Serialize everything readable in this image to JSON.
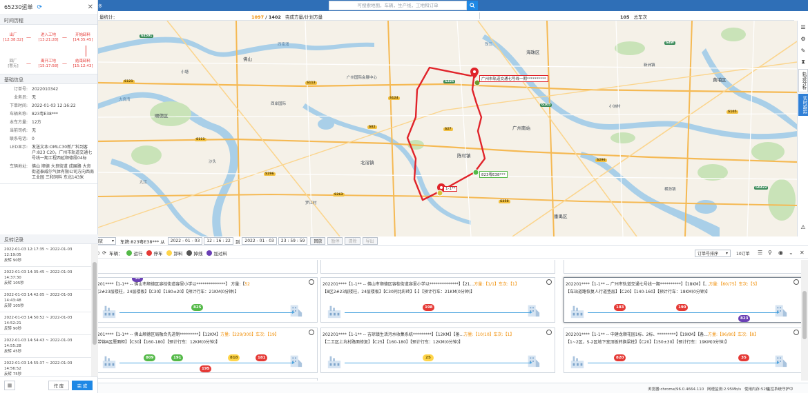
{
  "topbar": {
    "left_text": "多"
  },
  "search": {
    "placeholder": "可搜索地图，车辆，生产线，工地和订单"
  },
  "stats": {
    "left_label": "量统计：",
    "done": "1097",
    "total": "1402",
    "done_label": "完成方量/计划方量",
    "cars": "105",
    "cars_label": "总车次"
  },
  "left_panel": {
    "title": "65230运单",
    "timeline_title": "时间历程",
    "timeline": {
      "out_factory": {
        "label": "出厂",
        "time": "[12:38:32]"
      },
      "in_site": {
        "label": "进入工地",
        "time": "[13:21:28]"
      },
      "start_unload": {
        "label": "开始卸料",
        "time": "[14:35:45]"
      },
      "back_factory": {
        "label": "回厂",
        "time": "[暂无]"
      },
      "leave_site": {
        "label": "离开工地",
        "time": "[15:17:58]"
      },
      "end_unload": {
        "label": "结束卸料",
        "time": "[15:12:43]"
      }
    },
    "basic_title": "基础信息",
    "info": [
      {
        "key": "订单号:",
        "val": "2022010342"
      },
      {
        "key": "业务员:",
        "val": "无"
      },
      {
        "key": "下单时间:",
        "val": "2022-01-03 12:16:22"
      },
      {
        "key": "车辆名称:",
        "val": "823粤E38***"
      },
      {
        "key": "本车方量:",
        "val": "12方"
      },
      {
        "key": "当前司机:",
        "val": "无"
      },
      {
        "key": "联系电话:",
        "val": "0"
      },
      {
        "key": "LED显示:",
        "val": "发送文本:OMLC30新厂料到客户:823 C20，广州市轨道交通七号线一期工程西延顺德段04标"
      },
      {
        "key": "车辆地址:",
        "val": "佛山 顺德 大良街道 成展路 大良街道泰威尔气体有限公司方向西南工业园 三和饲料 东北143米"
      }
    ],
    "records_title": "反转记录",
    "records": [
      {
        "range": "2022-01-03 12:17:35 ~ 2022-01-03 12:19:05",
        "dur": "反转 90秒"
      },
      {
        "range": "2022-01-03 14:35:45 ~ 2022-01-03 14:37:30",
        "dur": "反转 105秒"
      },
      {
        "range": "2022-01-03 14:42:05 ~ 2022-01-03 14:43:48",
        "dur": "反转 105秒"
      },
      {
        "range": "2022-01-03 14:50:52 ~ 2022-01-03 14:52:21",
        "dur": "反转 90秒"
      },
      {
        "range": "2022-01-03 14:54:43 ~ 2022-01-03 14:55:28",
        "dur": "反转 45秒"
      },
      {
        "range": "2022-01-03 14:55:37 ~ 2022-01-03 14:56:52",
        "dur": "反转 75秒"
      }
    ],
    "btn_cancel": "作 废",
    "btn_finish": "完 成"
  },
  "map": {
    "labels": {
      "shunde": "顺德区",
      "guangzhou_south": "广州南站",
      "foshan": "佛山",
      "hotel": "广州国际会展中心",
      "airport": "西岸国际",
      "haizhu": "海珠区",
      "panyu": "番禺区",
      "xinzhou": "新洲镇",
      "huangpu": "黄埔区",
      "dalian": "大良湾",
      "yangcheng": "小洲村",
      "zhujiang": "珠江",
      "xianan": "西南涌",
      "jiujiang": "九江",
      "shatou": "沙头",
      "hengli": "横沥镇",
      "xiaotang": "小塘",
      "beijiao": "北滘镇",
      "chencun": "陈村镇",
      "luojiang": "罗江村"
    },
    "marker_top": "广州市轨道交通七号线一期**********",
    "marker_mid": "823粤E38***",
    "marker_bottom": "1-1**",
    "roads": [
      "S121",
      "S113",
      "G325",
      "S111",
      "G1501",
      "G105",
      "S82",
      "S263",
      "S296",
      "S105",
      "G4W",
      "S358",
      "S296",
      "G0423",
      "S124",
      "S27"
    ]
  },
  "side_tools": {
    "tool5": "轨迹分析",
    "tool6": "实时跟踪"
  },
  "playbar": {
    "mode": "回放",
    "car_label": "车牌:823粤E38*** 从",
    "start_date": "2022 - 01 - 03",
    "start_time": "12 : 16 : 22",
    "to": "到",
    "end_date": "2022 - 01 - 03",
    "end_time": "23 : 59 : 59",
    "btn_play": "回放",
    "btn_pause": "暂停",
    "btn_clear": "清除",
    "btn_export": "导出"
  },
  "legend": {
    "car_label": "车辆：",
    "items": [
      {
        "label": "运行",
        "color": "#54b948"
      },
      {
        "label": "停车",
        "color": "#e53935"
      },
      {
        "label": "卸料",
        "color": "#ffd54a"
      },
      {
        "label": "掉线",
        "color": "#555555"
      },
      {
        "label": "加过料",
        "color": "#6a3fb5"
      }
    ],
    "sort": "订单号排序",
    "count": "10订单"
  },
  "cards": [
    {
      "line1_pre": "201****【1-1** -- 佛山市顺德区容桂街道容里小学以**************】 方量:【",
      "done": "52",
      "plan": "/160】车次:【3】",
      "line2": "(2#23层楼柱，24层楼板】【C30】【180±20】【预计行车：21KM(0分钟)】",
      "pills": [
        {
          "v": "825",
          "c": "green"
        }
      ],
      "top_pill": {
        "v": "30",
        "c": "purple"
      }
    },
    {
      "line1_pre": "202201****【1-1** -- 佛山市顺德区容桂街道容里小学以**************】【21...",
      "done": "方量:【1/1】车次:【1】",
      "line2": "【8区2#23层楼柱，24层楼板】【C30同比彩砖】【-】【预计行车：21KM(0分钟)】",
      "pills": [
        {
          "v": "198",
          "c": "red"
        }
      ]
    },
    {
      "line1_pre": "202201****【1-1** -- 广州市轨道交通七号线一期**********】【18KM】【...",
      "done": "方量:【60/75】车次:【5】",
      "line2": "【车站道路恢复人行道垫层】【C20】【140-160】【预计行车：18KM(0分钟)】",
      "pills": [
        {
          "v": "183",
          "c": "red"
        },
        {
          "v": "190",
          "c": "red"
        },
        {
          "v": "823",
          "c": "purple"
        }
      ]
    },
    {
      "line1_pre": "201****【1-1** -- 佛山顺德区局融合先进制*********】【12KM】",
      "done": "方量:【229/300】车次:【19】",
      "line2": "带锦A区厘面柜】【C30】【160-180】【预计行车：12KM(0分钟)】",
      "pills": [
        {
          "v": "809",
          "c": "green"
        },
        {
          "v": "191",
          "c": "green"
        },
        {
          "v": "195",
          "c": "red"
        },
        {
          "v": "818",
          "c": "yellow"
        },
        {
          "v": "181",
          "c": "red"
        }
      ]
    },
    {
      "line1_pre": "202201****【1-1** -- 吉琼镇生活污水收集系统*********】【12KM】【备...",
      "done": "方量:【10/10】车次:【1】",
      "line2": "【二工区上坑村路面修复】【C25】【160-180】【预计行车：12KM(0分钟)】",
      "pills": [
        {
          "v": "25",
          "c": "yellow"
        }
      ]
    },
    {
      "line1_pre": "202201****【1-1** -- 中建龙顺花园1标、2标、*********】【19KM】【备...",
      "done": "方量:【96/80】车次:【8】",
      "line2": "【1~2区，S-2区地下室顶板转换梁柱】【C20】【150±30】【预计行车：19KM(0分钟)】",
      "pills": [
        {
          "v": "820",
          "c": "red"
        },
        {
          "v": "35",
          "c": "red"
        }
      ]
    }
  ],
  "status": {
    "browser": "浏览器:chrome/96.0.4664.110",
    "net": "网速监测:2.95Mb/s",
    "mem": "使用内存:52M",
    "app": "监控系统守护中"
  }
}
